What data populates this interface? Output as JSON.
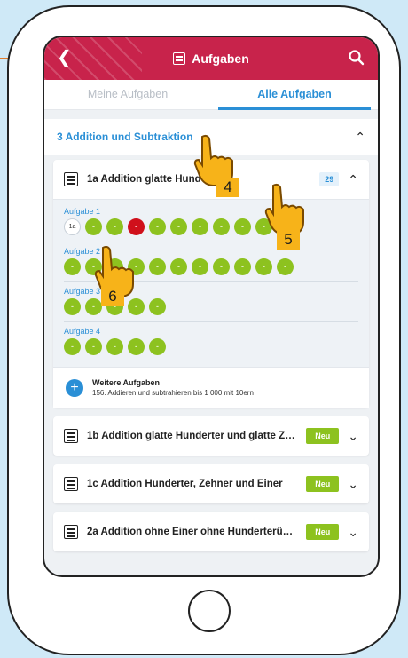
{
  "header": {
    "title": "Aufgaben"
  },
  "tabs": [
    {
      "label": "Meine Aufgaben",
      "active": false
    },
    {
      "label": "Alle Aufgaben",
      "active": true
    }
  ],
  "section": {
    "title": "3 Addition und Subtraktion"
  },
  "card_open": {
    "title": "1a Addition glatte Hunderter",
    "count": "29",
    "tasks": [
      {
        "label": "Aufgabe 1",
        "dots": [
          "1a",
          "-",
          "-",
          "-",
          "-",
          "-",
          "-",
          "-",
          "-",
          "-"
        ]
      },
      {
        "label": "Aufgabe 2",
        "dots": [
          "-",
          "-",
          "-",
          "-",
          "-",
          "-",
          "-",
          "-",
          "-",
          "-",
          "-"
        ]
      },
      {
        "label": "Aufgabe 3",
        "dots": [
          "-",
          "-",
          "-",
          "-",
          "-"
        ]
      },
      {
        "label": "Aufgabe 4",
        "dots": [
          "-",
          "-",
          "-",
          "-",
          "-"
        ]
      }
    ],
    "more": {
      "title": "Weitere Aufgaben",
      "subtitle": "156. Addieren und subtrahieren bis 1 000 mit 10ern"
    }
  },
  "cards_closed": [
    {
      "title": "1b Addition glatte Hunderter und glatte Ze...",
      "badge": "Neu"
    },
    {
      "title": "1c Addition Hunderter, Zehner und Einer",
      "badge": "Neu"
    },
    {
      "title": "2a Addition ohne Einer ohne Hunderterübe...",
      "badge": "Neu"
    }
  ],
  "markers": [
    "4",
    "5",
    "6"
  ],
  "colors": {
    "brand": "#c8234b",
    "accent": "#2a8fd6",
    "done": "#8dc21f",
    "wrong": "#d0101b",
    "marker": "#f7b319"
  }
}
